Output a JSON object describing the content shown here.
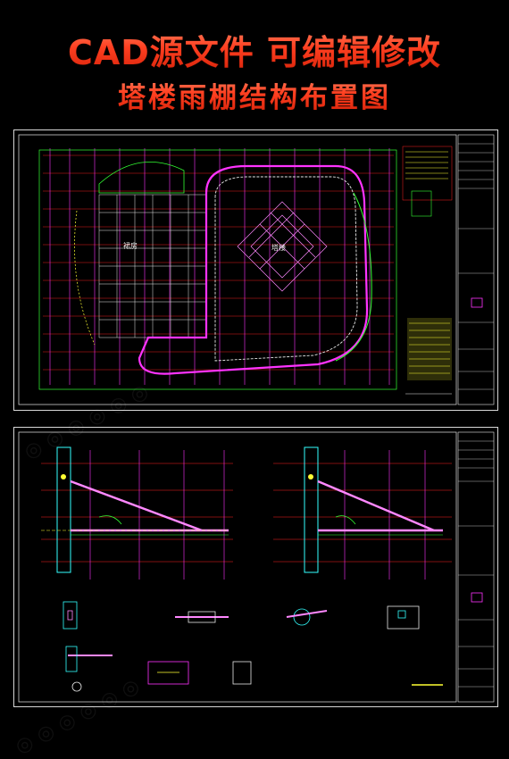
{
  "header": {
    "title_line1": "CAD源文件 可编辑修改",
    "title_line2": "塔楼雨棚结构布置图"
  },
  "sheet1": {
    "label_podium": "裙房",
    "label_tower": "塔楼"
  },
  "colors": {
    "background": "#000000",
    "title_red": "#ff3b1f",
    "cad_magenta": "#ff33ff",
    "cad_red": "#ff2020",
    "cad_green": "#33ff33",
    "cad_yellow": "#ffff33",
    "cad_cyan": "#33ffff",
    "cad_white": "#e8e8e8"
  }
}
